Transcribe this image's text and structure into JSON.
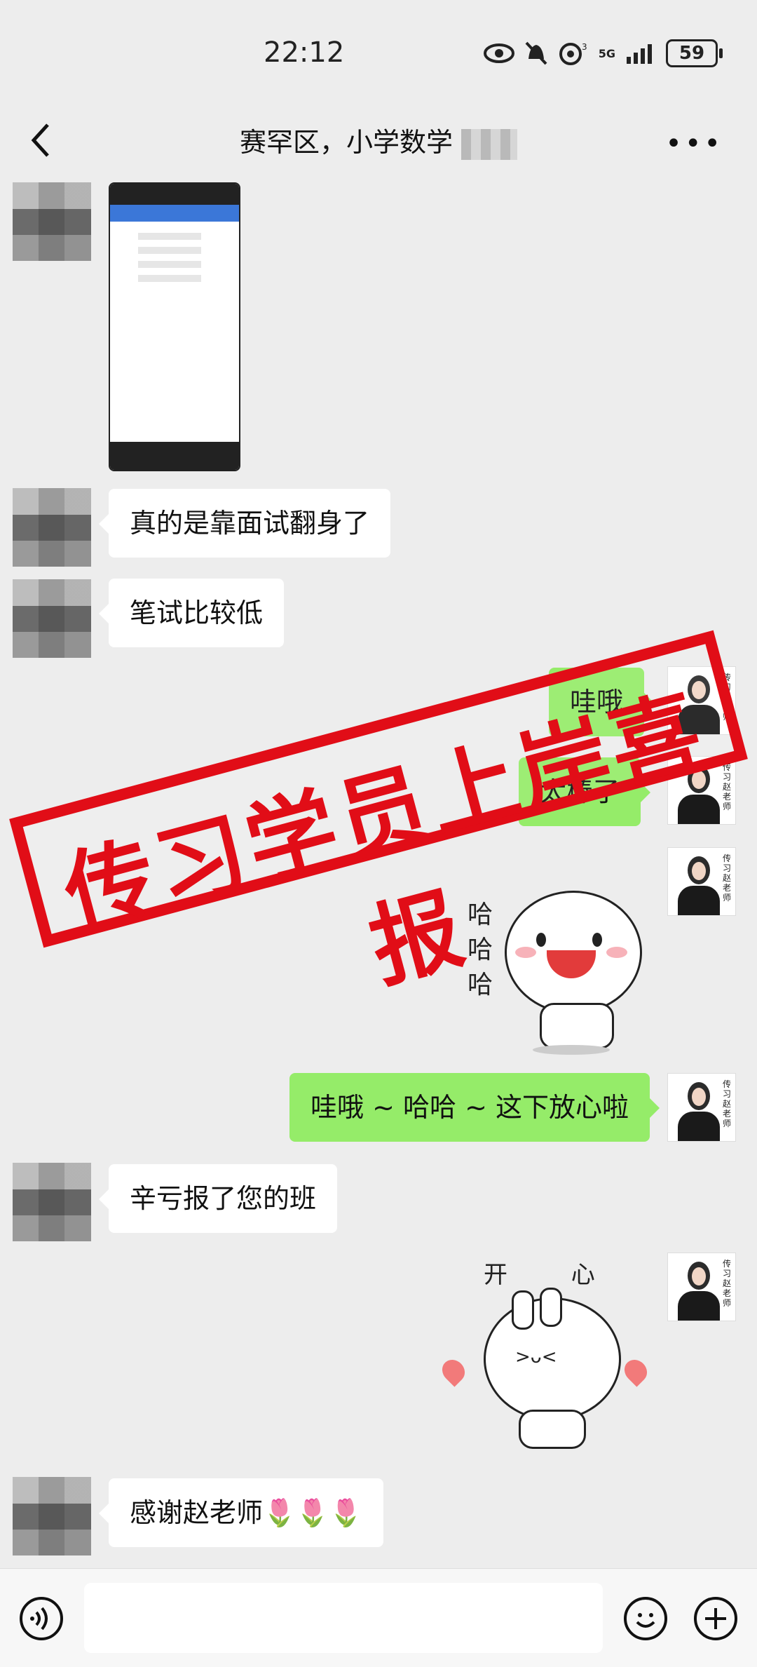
{
  "status": {
    "time": "22:12",
    "battery": "59",
    "network": "5G"
  },
  "header": {
    "title": "赛罕区，小学数学",
    "more_icon": "more-dots-icon",
    "back_icon": "back-chevron-icon"
  },
  "messages": [
    {
      "dir": "in",
      "text": "真的是靠面试翻身了"
    },
    {
      "dir": "in",
      "text": "笔试比较低"
    },
    {
      "dir": "out",
      "text": "哇哦"
    },
    {
      "dir": "out",
      "text": "太棒了"
    },
    {
      "dir": "out",
      "text": "哇哦 ~ 哈哈 ~ 这下放心啦"
    },
    {
      "dir": "in",
      "text": "辛亏报了您的班"
    },
    {
      "dir": "in",
      "text": "感谢赵老师🌷🌷🌷"
    }
  ],
  "sticker_text": {
    "laugh": [
      "哈",
      "哈",
      "哈"
    ],
    "happy": "开 心"
  },
  "teacher_avatar_text": "传习赵老师",
  "stamp": {
    "text": "传习学员上岸喜报",
    "color": "#e10d17"
  },
  "input_bar": {
    "voice_icon": "voice-icon",
    "emoji_icon": "emoji-icon",
    "plus_icon": "plus-icon"
  }
}
